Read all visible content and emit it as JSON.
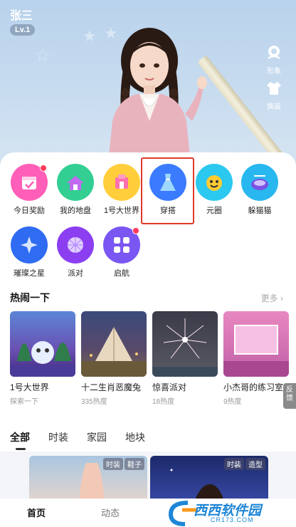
{
  "user": {
    "name": "张三",
    "level": "Lv.1"
  },
  "side_actions": [
    {
      "label": "形象",
      "icon": "avatar-shape-icon"
    },
    {
      "label": "换装",
      "icon": "outfit-change-icon"
    }
  ],
  "grid": [
    {
      "label": "今日奖励",
      "icon": "daily-reward-icon",
      "badge": true,
      "color": "#ff5fb8"
    },
    {
      "label": "我的地盘",
      "icon": "my-territory-icon",
      "badge": false,
      "color": "#33cf92"
    },
    {
      "label": "1号大世界",
      "icon": "world-one-icon",
      "badge": false,
      "color": "#ffce3a"
    },
    {
      "label": "穿搭",
      "icon": "dress-icon",
      "badge": false,
      "color": "#3a7bff",
      "highlighted": true
    },
    {
      "label": "元圈",
      "icon": "circle-emoji-icon",
      "badge": false,
      "color": "#2bc8f0"
    },
    {
      "label": "躲猫猫",
      "icon": "hide-seek-icon",
      "badge": false,
      "color": "#28b7ee"
    },
    {
      "label": "璀璨之星",
      "icon": "star-icon",
      "badge": false,
      "color": "#2f6cf2"
    },
    {
      "label": "派对",
      "icon": "disco-ball-icon",
      "badge": false,
      "color": "#8b3ff0"
    },
    {
      "label": "启航",
      "icon": "apps-grid-icon",
      "badge": true,
      "color": "#7a56f2"
    }
  ],
  "hot": {
    "title": "热闹一下",
    "more": "更多",
    "cards": [
      {
        "name": "1号大世界",
        "sub": "探索一下"
      },
      {
        "name": "十二生肖恶魔兔",
        "sub": "335热度"
      },
      {
        "name": "惊喜派对",
        "sub": "18热度"
      },
      {
        "name": "小杰哥的练习室",
        "sub": "9热度"
      }
    ]
  },
  "feedback": "反馈",
  "tabs": [
    "全部",
    "时装",
    "家园",
    "地块"
  ],
  "feed": [
    {
      "tags": [
        "时装",
        "鞋子"
      ]
    },
    {
      "tags": [
        "时装",
        "造型"
      ]
    }
  ],
  "bottom_nav": {
    "home": "首页",
    "dynamic": "动态"
  },
  "watermark": {
    "text": "西西软件园",
    "url": "CR173.COM"
  },
  "colors": {
    "accent": "#e0392b",
    "sheet": "#ffffff",
    "hero": "#c8dcef"
  }
}
